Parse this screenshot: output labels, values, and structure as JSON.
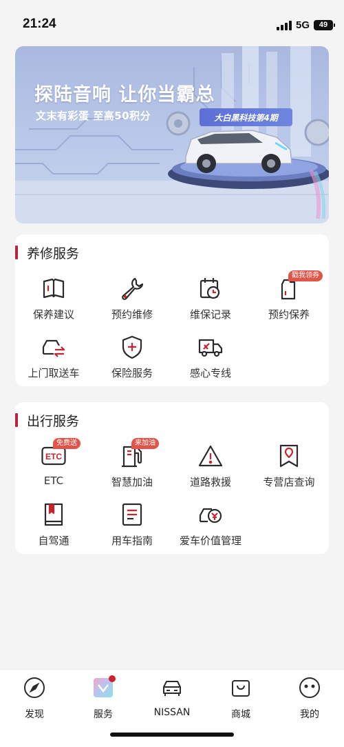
{
  "status_bar": {
    "time": "21:24",
    "network": "5G",
    "battery": "49"
  },
  "banner": {
    "title": "探陆音响 让你当霸总",
    "subtitle": "文末有彩蛋 至高50积分",
    "tag": "大白黑科技第4期"
  },
  "maintenance": {
    "title": "养修服务",
    "items": [
      {
        "label": "保养建议",
        "icon": "book-icon"
      },
      {
        "label": "预约维修",
        "icon": "wrench-icon"
      },
      {
        "label": "维保记录",
        "icon": "calendar-clock-icon"
      },
      {
        "label": "预约保养",
        "icon": "oil-can-icon",
        "badge": "戳我领券"
      },
      {
        "label": "上门取送车",
        "icon": "car-transfer-icon"
      },
      {
        "label": "保险服务",
        "icon": "shield-plus-icon"
      },
      {
        "label": "感心专线",
        "icon": "truck-tools-icon"
      }
    ]
  },
  "travel": {
    "title": "出行服务",
    "items": [
      {
        "label": "ETC",
        "icon": "etc-icon",
        "icon_text": "ETC",
        "badge": "免费送"
      },
      {
        "label": "智慧加油",
        "icon": "fuel-pump-icon",
        "badge": "来加油"
      },
      {
        "label": "道路救援",
        "icon": "warning-triangle-icon"
      },
      {
        "label": "专营店查询",
        "icon": "location-pin-icon"
      },
      {
        "label": "自驾通",
        "icon": "travel-book-icon"
      },
      {
        "label": "用车指南",
        "icon": "guide-icon"
      },
      {
        "label": "爱车价值管理",
        "icon": "car-value-icon"
      }
    ]
  },
  "bottom_nav": [
    {
      "label": "发现",
      "icon": "compass-icon"
    },
    {
      "label": "服务",
      "icon": "service-icon",
      "active": true
    },
    {
      "label": "NISSAN",
      "icon": "car-front-icon"
    },
    {
      "label": "商城",
      "icon": "shopping-bag-icon"
    },
    {
      "label": "我的",
      "icon": "face-icon"
    }
  ],
  "colors": {
    "accent": "#b5263a",
    "badge": "#e2544a",
    "icon_stroke": "#2a2a2a",
    "icon_red": "#c8242f"
  }
}
